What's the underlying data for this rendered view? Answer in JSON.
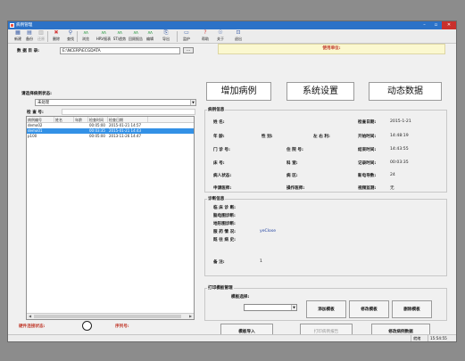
{
  "window": {
    "title": "病例管理"
  },
  "toolbar": {
    "tools": [
      {
        "icon": "new-icon",
        "glyph": "▦",
        "label": "新建"
      },
      {
        "icon": "backup-icon",
        "glyph": "▤",
        "label": "备份"
      },
      {
        "icon": "restore-icon",
        "glyph": "▥",
        "label": "还原",
        "disabled": true
      },
      {
        "icon": "delete-icon",
        "glyph": "✖",
        "label": "删除",
        "red": true
      },
      {
        "icon": "search-icon",
        "glyph": "⚲",
        "label": "查找"
      },
      {
        "icon": "ecg-icon",
        "glyph": "ʌʌ",
        "label": "浏览"
      },
      {
        "icon": "ecg-report-icon",
        "glyph": "ʌʌ",
        "label": "HRV报表"
      },
      {
        "icon": "ecg-list-icon",
        "glyph": "ʌʌ",
        "label": "ST/趋势"
      },
      {
        "icon": "ecg-review-icon",
        "glyph": "ʌʌ",
        "label": "回顾报告"
      },
      {
        "icon": "ecg-edit-icon",
        "glyph": "ʌʌ",
        "label": "编辑"
      },
      {
        "icon": "export-icon",
        "glyph": "⎘",
        "label": "导出"
      },
      {
        "icon": "monitor-icon",
        "glyph": "▭",
        "label": "监护"
      },
      {
        "icon": "help-icon",
        "glyph": "?",
        "label": "帮助",
        "red": true
      },
      {
        "icon": "about-icon",
        "glyph": "☉",
        "label": "关于"
      },
      {
        "icon": "exit-icon",
        "glyph": "⊡",
        "label": "退出"
      }
    ]
  },
  "left": {
    "data_dir_label": "数 据 目 录:",
    "data_dir_value": "E:\\NCERP\\ECGDATA",
    "browse_label": "...",
    "case_status_label": "请选择病例状态:",
    "case_status_value": "未处理",
    "search_label": "检  查  号:",
    "search_value": "",
    "table": {
      "headers": [
        "病例编号",
        "姓名",
        "年龄",
        "检查时间",
        "检查日期"
      ],
      "rows": [
        [
          "demo02",
          "",
          "",
          "00:05:00",
          "2015-01-21 14:57"
        ],
        [
          "demo01",
          "",
          "",
          "00:03:35",
          "2015-01-21 14:43"
        ],
        [
          "p100",
          "",
          "",
          "00:05:00",
          "2013-11-26 14:47"
        ]
      ],
      "selected_index": 1
    },
    "hw_status_label": "硬件连接状态:",
    "serial_label": "序列号:"
  },
  "right": {
    "unit_label": "使用单位:",
    "big_buttons": [
      "增加病例",
      "系统设置",
      "动态数据"
    ],
    "case_info": {
      "title": "病例信息",
      "name_label": "姓    名:",
      "check_date_label": "检查日期:",
      "check_date_value": "2015-1-21",
      "age_label": "年    龄:",
      "sex_label": "性    别:",
      "lr_label": "左  右  利:",
      "start_time_label": "开始时间:",
      "start_time_value": "14:48:19",
      "clinic_label": "门  诊  号:",
      "hosp_label": "住  院  号:",
      "end_time_label": "结束时间:",
      "end_time_value": "14:43:55",
      "bed_label": "床    号:",
      "dept_label": "科    室:",
      "duration_label": "记录时间:",
      "duration_value": "00:03:35",
      "status_label": "病人状态:",
      "ward_label": "病    区:",
      "leads_label": "新电导数:",
      "leads_value": "24",
      "applicant_label": "申请医师:",
      "operator_label": "操作医师:",
      "video_label": "视频监测:",
      "video_value": "无"
    },
    "diag_info": {
      "title": "诊断信息",
      "clinical_label": "临 床 诊 断:",
      "eeg_label": "脑电图诊断:",
      "topo_label": "地形图诊断:",
      "med_label": "服 药 情 况:",
      "med_value": "yeClose",
      "history_label": "既 往 病 史:",
      "remark_label": "备        注:",
      "remark_value": "1"
    },
    "print_tpl": {
      "title": "打印模板管理",
      "tpl_label": "模板选择:",
      "add_btn": "添加模板",
      "edit_btn": "修改模板",
      "del_btn": "删除模板"
    },
    "bottom_buttons": {
      "import": "模板导入",
      "print": "打印病例报告",
      "modify": "修改病例数据"
    }
  },
  "statusbar": {
    "cell1": "就绪",
    "time": "15:54:55"
  }
}
